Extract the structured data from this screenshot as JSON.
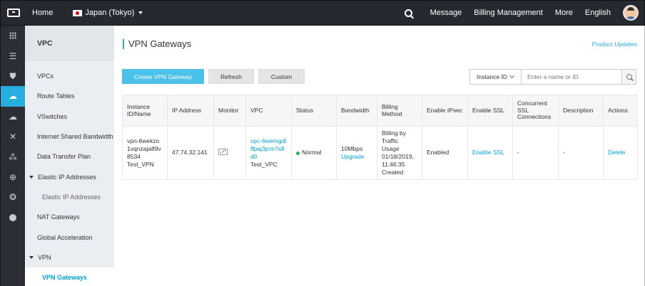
{
  "topbar": {
    "home": "Home",
    "region": "Japan (Tokyo)",
    "message": "Message",
    "billing": "Billing Management",
    "more": "More",
    "language": "English"
  },
  "rail": {
    "icons": [
      "grid-icon",
      "list-icon",
      "shield-icon",
      "cloud-icon",
      "cloud-link-icon",
      "cross-arrows-icon",
      "network-icon",
      "globe-icon",
      "cdn-icon",
      "circle-icon"
    ],
    "active_index": 3
  },
  "nav": {
    "title": "VPC",
    "items": {
      "vpcs": "VPCs",
      "route_tables": "Route Tables",
      "vswitches": "VSwitches",
      "internet_shared_bandwidth": "Internet Shared Bandwidth",
      "data_transfer_plan": "Data Transfer Plan",
      "elastic_ip_group": "Elastic IP Addresses",
      "elastic_ip_sub": "Elastic IP Addresses",
      "nat_gateways": "NAT Gateways",
      "global_acceleration": "Global Acceleration",
      "vpn_group": "VPN",
      "vpn_gateways": "VPN Gateways"
    }
  },
  "main": {
    "title": "VPN Gateways",
    "product_updates": "Product Updates",
    "buttons": {
      "create": "Create VPN Gateway",
      "refresh": "Refresh",
      "custom": "Custom"
    },
    "filter": {
      "field": "Instance ID",
      "placeholder": "Enter a name or ID"
    },
    "table": {
      "headers": {
        "instance": "Instance ID/Name",
        "ip": "IP Address",
        "monitor": "Monitor",
        "vpc": "VPC",
        "status": "Status",
        "bandwidth": "Bandwidth",
        "billing": "Billing Method",
        "ipsec": "Enable IPsec",
        "ssl": "Enable SSL",
        "concurrent": "Concurrent SSL Connections",
        "description": "Description",
        "actions": "Actions"
      },
      "row": {
        "instance_id": "vpn-6wekzo1vqnzaja89v8534",
        "instance_name": "Test_VPN",
        "ip": "47.74.32.141",
        "vpc_id": "vpc-6wemgdlffpaj3jcm7s8d0",
        "vpc_name": "Test_VPC",
        "status": "Normal",
        "bandwidth": "10Mbps",
        "upgrade": "Upgrade",
        "billing": "Billing by Traffic Usage 01/18/2019, 11:46:35 Created",
        "ipsec": "Enabled",
        "ssl": "Enable SSL",
        "concurrent": "-",
        "description": "-",
        "action": "Delete"
      }
    }
  }
}
